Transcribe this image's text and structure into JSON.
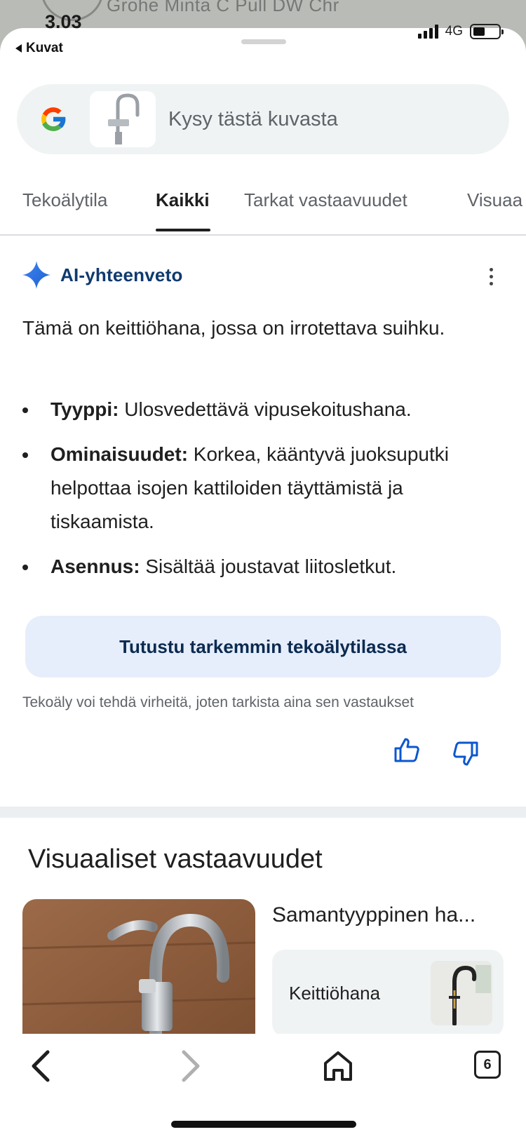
{
  "backdrop": {
    "title": "Grohe Minta C Pull DW Chr"
  },
  "status_bar": {
    "time": "3.03",
    "network": "4G",
    "back_app": "Kuvat"
  },
  "search": {
    "placeholder": "Kysy tästä kuvasta"
  },
  "tabs": [
    {
      "label": "Tekoälytila",
      "active": false
    },
    {
      "label": "Kaikki",
      "active": true
    },
    {
      "label": "Tarkat vastaavuudet",
      "active": false
    },
    {
      "label": "Visuaa",
      "active": false
    }
  ],
  "ai_overview": {
    "title": "AI-yhteenveto",
    "summary": "Tämä on keittiöhana, jossa on irrotettava suihku.",
    "bullets": [
      {
        "label": "Tyyppi:",
        "text": "Ulosvedettävä vipusekoitushana."
      },
      {
        "label": "Ominaisuudet:",
        "text": "Korkea, kääntyvä juoksuputki helpottaa isojen kattiloiden täyttämistä ja tiskaamista."
      },
      {
        "label": "Asennus:",
        "text": "Sisältää joustavat liitosletkut."
      }
    ],
    "explore_button": "Tutustu tarkemmin tekoälytilassa",
    "disclaimer": "Tekoäly voi tehdä virheitä, joten tarkista aina sen vastaukset"
  },
  "visual_matches": {
    "title": "Visuaaliset vastaavuudet",
    "similar_heading": "Samantyyppinen ha...",
    "similar_items": [
      {
        "label": "Keittiöhana"
      }
    ]
  },
  "bottom_nav": {
    "tab_count": "6"
  },
  "colors": {
    "accent": "#0b57d0",
    "chip_bg": "#e6eefb",
    "search_bg": "#f0f3f4"
  }
}
